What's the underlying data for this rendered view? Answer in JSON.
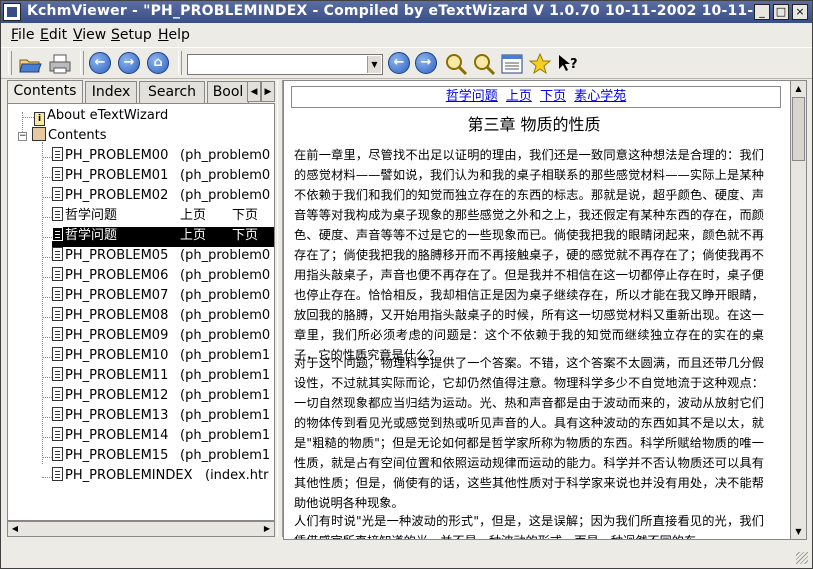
{
  "window": {
    "title": "KchmViewer - \"PH_PROBLEMINDEX    - Compiled by eTextWizard V 1.0.70     10-11-2002  10-11-2",
    "buttons": [
      "_",
      "□",
      "×"
    ]
  },
  "menu": [
    {
      "label": "File",
      "accel": "F",
      "rest": "ile"
    },
    {
      "label": "Edit",
      "accel": "E",
      "rest": "dit"
    },
    {
      "label": "View",
      "accel": "V",
      "rest": "iew"
    },
    {
      "label": "Setup",
      "accel": "S",
      "rest": "etup"
    },
    {
      "label": "Help",
      "accel": "H",
      "rest": "elp"
    }
  ],
  "toolbar": {
    "icons": [
      "open-folder-icon",
      "print-icon",
      "back-icon",
      "forward-icon",
      "home-icon",
      "prev-page-icon",
      "next-page-icon",
      "zoom-in-icon",
      "zoom-out-icon",
      "source-view-icon",
      "bookmark-star-icon",
      "whats-this-icon"
    ],
    "url_value": ""
  },
  "tabs": [
    "Contents",
    "Index",
    "Search",
    "Bool"
  ],
  "tree": {
    "root_items": [
      {
        "label": "About eTextWizard"
      },
      {
        "label": "Contents"
      }
    ],
    "children": [
      {
        "label": "PH_PROBLEM00",
        "extra": "(ph_problem0"
      },
      {
        "label": "PH_PROBLEM01",
        "extra": "(ph_problem0"
      },
      {
        "label": "PH_PROBLEM02",
        "extra": "(ph_problem0"
      },
      {
        "label": "哲学问题",
        "extra": "上页　　下页"
      },
      {
        "label": "哲学问题",
        "extra": "上页　　下页"
      },
      {
        "label": "PH_PROBLEM05",
        "extra": "(ph_problem0"
      },
      {
        "label": "PH_PROBLEM06",
        "extra": "(ph_problem0"
      },
      {
        "label": "PH_PROBLEM07",
        "extra": "(ph_problem0"
      },
      {
        "label": "PH_PROBLEM08",
        "extra": "(ph_problem0"
      },
      {
        "label": "PH_PROBLEM09",
        "extra": "(ph_problem0"
      },
      {
        "label": "PH_PROBLEM10",
        "extra": "(ph_problem1"
      },
      {
        "label": "PH_PROBLEM11",
        "extra": "(ph_problem1"
      },
      {
        "label": "PH_PROBLEM12",
        "extra": "(ph_problem1"
      },
      {
        "label": "PH_PROBLEM13",
        "extra": "(ph_problem1"
      },
      {
        "label": "PH_PROBLEM14",
        "extra": "(ph_problem1"
      },
      {
        "label": "PH_PROBLEM15",
        "extra": "(ph_problem1"
      },
      {
        "label": "PH_PROBLEMINDEX",
        "extra": "(index.htr"
      }
    ],
    "selected_index": 4
  },
  "content": {
    "nav_links": [
      "哲学问题",
      "上页",
      "下页",
      "素心学苑"
    ],
    "heading": "第三章 物质的性质",
    "paragraphs": [
      "在前一章里，尽管找不出足以证明的理由，我们还是一致同意这种想法是合理的：我们的感觉材料——譬如说，我们认为和我的桌子相联系的那些感觉材料——实际上是某种不依赖于我们和我们的知觉而独立存在的东西的标志。那就是说，超乎颜色、硬度、声音等等对我构成为桌子现象的那些感觉之外和之上，我还假定有某种东西的存在，而颜色、硬度、声音等等不过是它的一些现象而已。倘使我把我的眼睛闭起来，颜色就不再存在了；倘使我把我的胳膊移开而不再接触桌子，硬的感觉就不再存在了；倘使我再不用指头敲桌子，声音也便不再存在了。但是我并不相信在这一切都停止存在时，桌子便也停止存在。恰恰相反，我却相信正是因为桌子继续存在，所以才能在我又睁开眼睛，放回我的胳膊，又开始用指头敲桌子的时候，所有这一切感觉材料又重新出现。在这一章里，我们所必须考虑的问题是：这个不依赖于我的知觉而继续独立存在的实在的桌子，它的性质究竟是什么？",
      "对于这个问题，物理科学提供了一个答案。不错，这个答案不太圆满，而且还带几分假设性，不过就其实际而论，它却仍然值得注意。物理科学多少不自觉地流于这种观点：一切自然现象都应当归结为运动。光、热和声音都是由于波动而来的，波动从放射它们的物体传到看见光或感觉到热或听见声音的人。具有这种波动的东西如其不是以太，就是\"粗糙的物质\"；但是无论如何都是哲学家所称为物质的东西。科学所赋给物质的唯一性质，就是占有空间位置和依照运动规律而运动的能力。科学并不否认物质还可以具有其他性质；但是，倘使有的话，这些其他性质对于科学家来说也并没有用处，决不能帮助他说明各种现象。",
      "人们有时说\"光是一种波动的形式\"，但是，这是误解；因为我们所直接看见的光，我们凭借感官所直接知道的光，并不是一种波动的形式，而是一种迥然不同的东"
    ]
  }
}
